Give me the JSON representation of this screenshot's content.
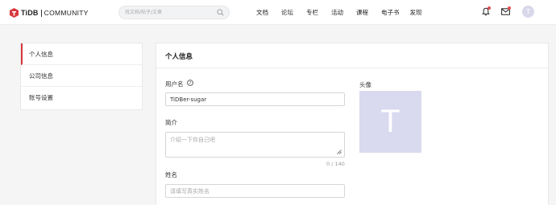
{
  "header": {
    "logo_text": "TiDB",
    "logo_sub": "COMMUNITY",
    "search_placeholder": "找文档/帖子/文章",
    "nav": [
      "文档",
      "论坛",
      "专栏",
      "活动",
      "课程",
      "电子书",
      "发现"
    ],
    "user_initial": "T",
    "colors": {
      "brand": "#d9363e",
      "notification_dot": "#e24d4d"
    }
  },
  "sidebar": {
    "items": [
      {
        "label": "个人信息",
        "active": true
      },
      {
        "label": "公司信息",
        "active": false
      },
      {
        "label": "账号设置",
        "active": false
      }
    ]
  },
  "main": {
    "title": "个人信息",
    "username_label": "用户名",
    "username_value": "TiDBer-sugar",
    "bio_label": "简介",
    "bio_placeholder": "介绍一下你自己吧",
    "bio_counter": "0 / 140",
    "name_label": "姓名",
    "name_placeholder": "请填写真实姓名",
    "avatar_label": "头像",
    "avatar_initial": "T",
    "avatar_color": "#d9d9ef"
  }
}
